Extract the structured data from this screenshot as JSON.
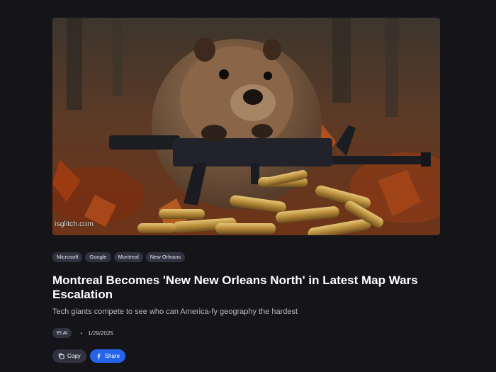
{
  "hero": {
    "watermark": "isglitch.com"
  },
  "tags": [
    "Microsoft",
    "Google",
    "Montreal",
    "New Orleans"
  ],
  "article": {
    "title": "Montreal Becomes 'New New Orleans North' in Latest Map Wars Escalation",
    "subtitle": "Tech giants compete to see who can America-fy geography the hardest"
  },
  "meta": {
    "author": "Et Al",
    "separator": "•",
    "date": "1/29/2025"
  },
  "actions": {
    "copy_label": "Copy",
    "copy_icon": "copy-icon",
    "share_label": "Share",
    "share_icon": "facebook-icon"
  },
  "colors": {
    "background": "#141419",
    "tag_background": "#30323f",
    "share_button": "#2563eb"
  }
}
